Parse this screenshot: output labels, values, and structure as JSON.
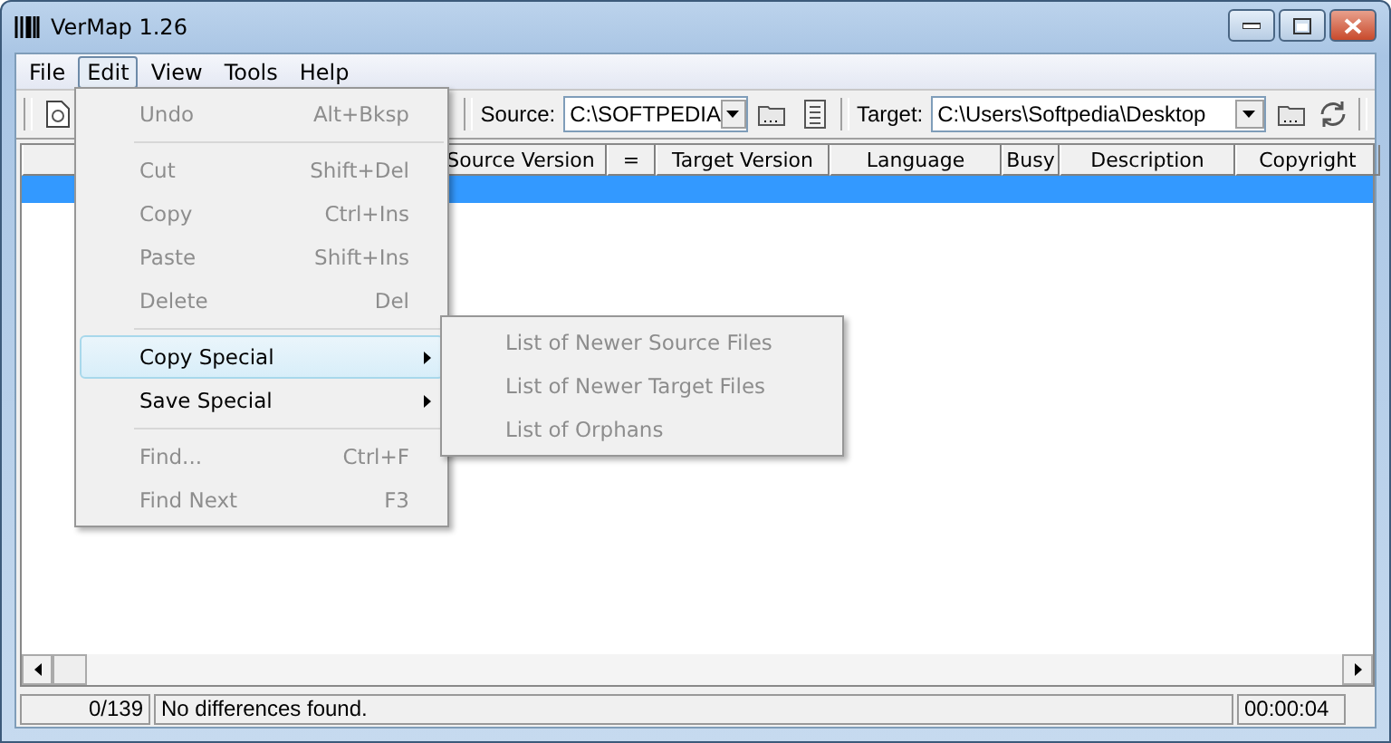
{
  "window": {
    "title": "VerMap 1.26"
  },
  "menu_bar": [
    {
      "label": "File",
      "selected": false
    },
    {
      "label": "Edit",
      "selected": true
    },
    {
      "label": "View",
      "selected": false
    },
    {
      "label": "Tools",
      "selected": false
    },
    {
      "label": "Help",
      "selected": false
    }
  ],
  "toolbar": {
    "source_label": "Source:",
    "source_value": "C:\\SOFTPEDIA",
    "target_label": "Target:",
    "target_value": "C:\\Users\\Softpedia\\Desktop"
  },
  "table": {
    "columns": [
      "Source Version",
      "=",
      "Target Version",
      "Language",
      "Busy",
      "Description",
      "Copyright"
    ],
    "rows": [
      {
        "selected": true
      }
    ]
  },
  "edit_menu": {
    "items": [
      {
        "kind": "item",
        "label": "Undo",
        "shortcut": "Alt+Bksp",
        "disabled": true,
        "selected": false,
        "submenu": false
      },
      {
        "kind": "separator"
      },
      {
        "kind": "item",
        "label": "Cut",
        "shortcut": "Shift+Del",
        "disabled": true,
        "selected": false,
        "submenu": false
      },
      {
        "kind": "item",
        "label": "Copy",
        "shortcut": "Ctrl+Ins",
        "disabled": true,
        "selected": false,
        "submenu": false
      },
      {
        "kind": "item",
        "label": "Paste",
        "shortcut": "Shift+Ins",
        "disabled": true,
        "selected": false,
        "submenu": false
      },
      {
        "kind": "item",
        "label": "Delete",
        "shortcut": "Del",
        "disabled": true,
        "selected": false,
        "submenu": false
      },
      {
        "kind": "separator"
      },
      {
        "kind": "item",
        "label": "Copy Special",
        "disabled": false,
        "selected": true,
        "submenu": true
      },
      {
        "kind": "item",
        "label": "Save Special",
        "disabled": false,
        "selected": false,
        "submenu": true
      },
      {
        "kind": "separator"
      },
      {
        "kind": "item",
        "label": "Find...",
        "shortcut": "Ctrl+F",
        "disabled": true,
        "selected": false,
        "submenu": false
      },
      {
        "kind": "item",
        "label": "Find Next",
        "shortcut": "F3",
        "disabled": true,
        "selected": false,
        "submenu": false
      }
    ]
  },
  "submenu": {
    "items": [
      {
        "label": "List of Newer Source Files",
        "disabled": true
      },
      {
        "label": "List of Newer Target Files",
        "disabled": true
      },
      {
        "label": "List of Orphans",
        "disabled": true
      }
    ]
  },
  "status_bar": {
    "count": "0/139",
    "message": "No differences found.",
    "time": "00:00:04"
  }
}
